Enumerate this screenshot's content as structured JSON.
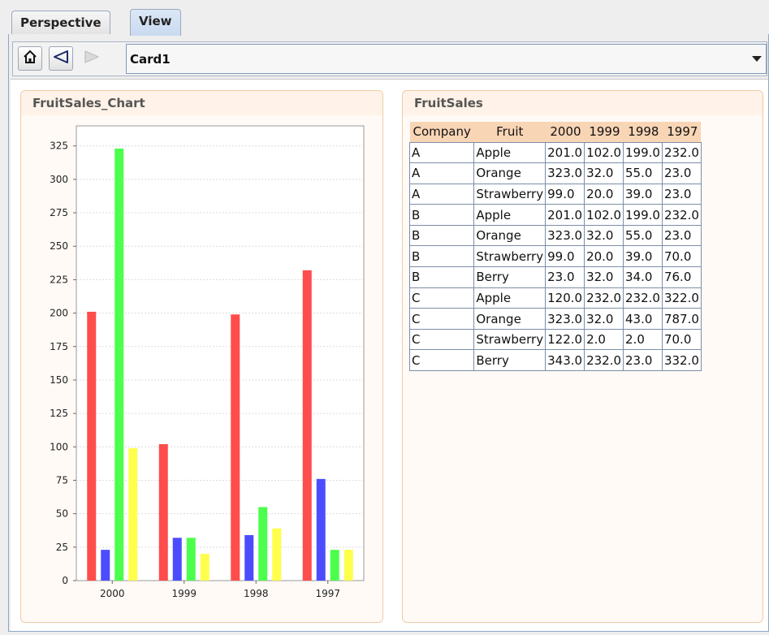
{
  "tabs": [
    {
      "label": "Perspective",
      "active": false
    },
    {
      "label": "View",
      "active": true
    }
  ],
  "toolbar": {
    "home_icon": "home-icon",
    "back_icon": "back-arrow-icon",
    "forward_icon": "forward-arrow-icon",
    "card_value": "Card1"
  },
  "chart_panel": {
    "title": "FruitSales_Chart"
  },
  "chart_data": {
    "type": "bar",
    "categories": [
      "2000",
      "1999",
      "1998",
      "1997"
    ],
    "series": [
      {
        "color": "#ff4c4c",
        "values": [
          201,
          102,
          199,
          232
        ]
      },
      {
        "color": "#4c4cff",
        "values": [
          23,
          32,
          34,
          76
        ]
      },
      {
        "color": "#4cff4c",
        "values": [
          323,
          32,
          55,
          23
        ]
      },
      {
        "color": "#ffff4c",
        "values": [
          99,
          20,
          39,
          23
        ]
      }
    ],
    "ylim": [
      0,
      340
    ],
    "yticks": [
      0,
      25,
      50,
      75,
      100,
      125,
      150,
      175,
      200,
      225,
      250,
      275,
      300,
      325
    ],
    "grid": true,
    "legend": "none"
  },
  "table_panel": {
    "title": "FruitSales",
    "columns": [
      "Company",
      "Fruit",
      "2000",
      "1999",
      "1998",
      "1997"
    ],
    "rows": [
      [
        "A",
        "Apple",
        "201.0",
        "102.0",
        "199.0",
        "232.0"
      ],
      [
        "A",
        "Orange",
        "323.0",
        "32.0",
        "55.0",
        "23.0"
      ],
      [
        "A",
        "Strawberry",
        "99.0",
        "20.0",
        "39.0",
        "23.0"
      ],
      [
        "B",
        "Apple",
        "201.0",
        "102.0",
        "199.0",
        "232.0"
      ],
      [
        "B",
        "Orange",
        "323.0",
        "32.0",
        "55.0",
        "23.0"
      ],
      [
        "B",
        "Strawberry",
        "99.0",
        "20.0",
        "39.0",
        "70.0"
      ],
      [
        "B",
        "Berry",
        "23.0",
        "32.0",
        "34.0",
        "76.0"
      ],
      [
        "C",
        "Apple",
        "120.0",
        "232.0",
        "232.0",
        "322.0"
      ],
      [
        "C",
        "Orange",
        "323.0",
        "32.0",
        "43.0",
        "787.0"
      ],
      [
        "C",
        "Strawberry",
        "122.0",
        "2.0",
        "2.0",
        "70.0"
      ],
      [
        "C",
        "Berry",
        "343.0",
        "232.0",
        "23.0",
        "332.0"
      ]
    ]
  }
}
